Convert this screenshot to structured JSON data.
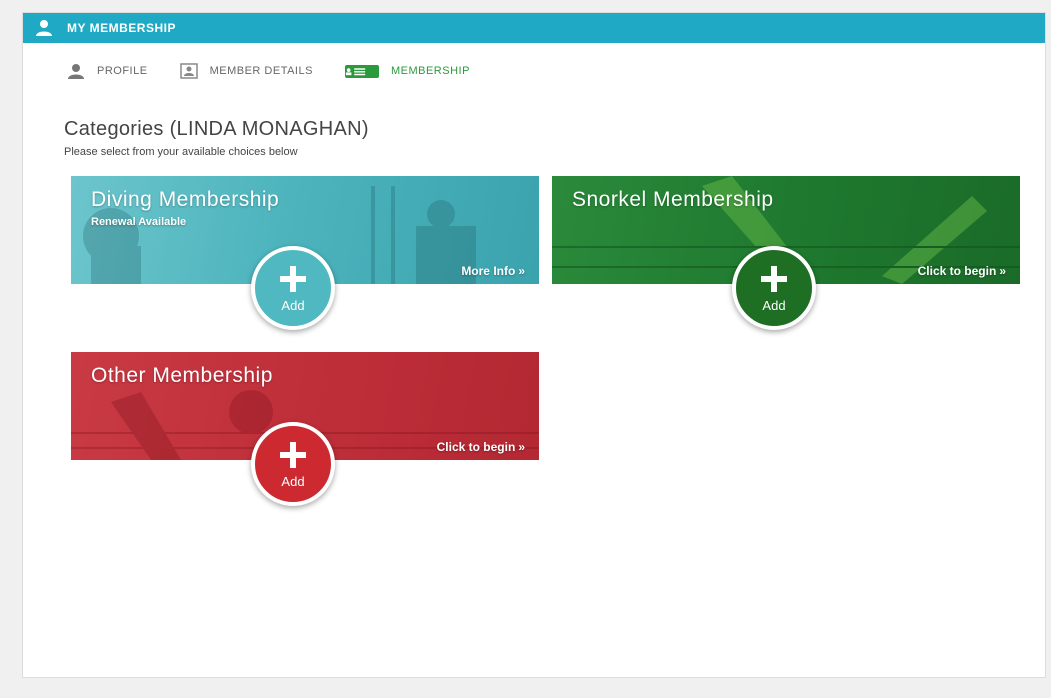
{
  "header": {
    "title": "MY MEMBERSHIP",
    "icon": "user-icon",
    "color": "#1fa9c4"
  },
  "tabs": [
    {
      "label": "PROFILE",
      "icon": "user-icon",
      "active": false
    },
    {
      "label": "MEMBER DETAILS",
      "icon": "id-card-icon",
      "active": false
    },
    {
      "label": "MEMBERSHIP",
      "icon": "membership-card-icon",
      "active": true
    }
  ],
  "main": {
    "title": "Categories (LINDA MONAGHAN)",
    "subtitle": "Please select from your available choices below"
  },
  "cards": [
    {
      "title": "Diving Membership",
      "subtitle": "Renewal Available",
      "link": "More Info",
      "add_label": "Add",
      "color": "#4fb8c0"
    },
    {
      "title": "Snorkel Membership",
      "subtitle": "",
      "link": "Click to begin",
      "add_label": "Add",
      "color": "#1e7a2e"
    },
    {
      "title": "Other Membership",
      "subtitle": "",
      "link": "Click to begin",
      "add_label": "Add",
      "color": "#c4303a"
    }
  ],
  "colors": {
    "active_tab": "#2b9a3c",
    "inactive_tab": "#666666"
  }
}
